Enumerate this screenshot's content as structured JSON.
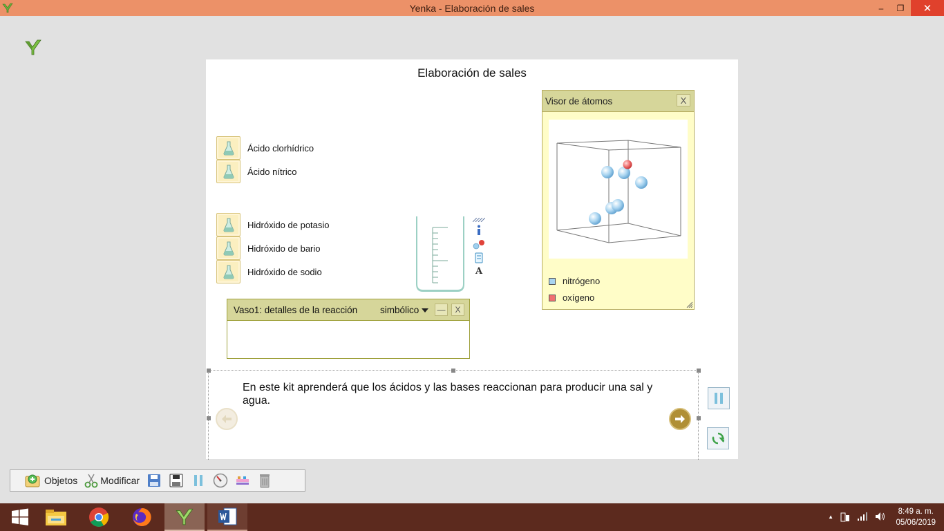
{
  "window": {
    "title": "Yenka - Elaboración de sales",
    "minimize_glyph": "–",
    "maximize_glyph": "❐",
    "close_glyph": "✕"
  },
  "canvas": {
    "title": "Elaboración de sales"
  },
  "acids": [
    {
      "label": "Ácido clorhídrico"
    },
    {
      "label": "Ácido nítrico"
    }
  ],
  "bases": [
    {
      "label": "Hidróxido de potasio"
    },
    {
      "label": "Hidróxido de bario"
    },
    {
      "label": "Hidróxido de sodio"
    }
  ],
  "beaker_tools": {
    "text_tool_glyph": "A"
  },
  "reaction_panel": {
    "title": "Vaso1: detalles de la reacción",
    "mode": "simbólico",
    "minimize_glyph": "—",
    "close_glyph": "X"
  },
  "atom_viewer": {
    "title": "Visor de átomos",
    "close_glyph": "X",
    "legend": [
      {
        "label": "nitrógeno",
        "color": "#a8d4f0"
      },
      {
        "label": "oxígeno",
        "color": "#f07070"
      }
    ]
  },
  "tutorial": {
    "text": "En este kit aprenderá que los ácidos y las bases reaccionan para producir una sal y agua."
  },
  "toolbar": {
    "objects_label": "Objetos",
    "modify_label": "Modificar"
  },
  "taskbar": {
    "time": "8:49 a. m.",
    "date": "05/06/2019",
    "tray_arrow": "▲"
  },
  "colors": {
    "titlebar": "#ec9168",
    "panel_header": "#d6d69a",
    "taskbar": "#5c2a1e"
  }
}
